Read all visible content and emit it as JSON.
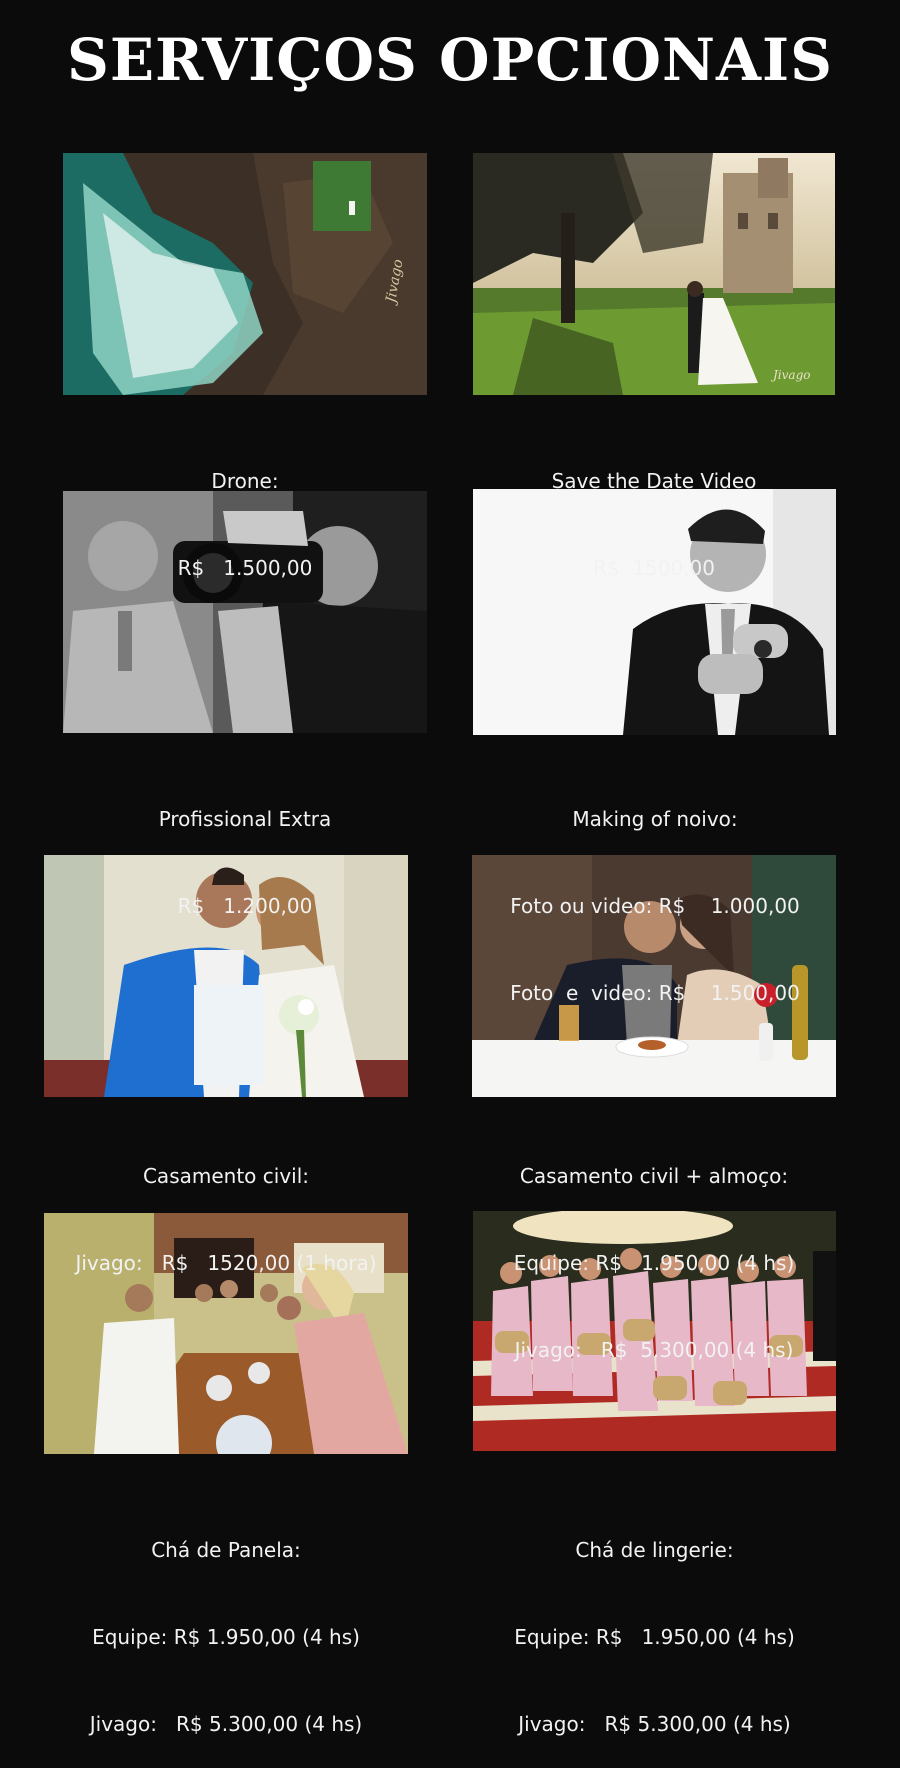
{
  "page": {
    "title": "SERVIÇOS OPCIONAIS"
  },
  "services": [
    {
      "id": "drone",
      "lines": [
        "Drone:",
        "R$   1.500,00"
      ]
    },
    {
      "id": "save-the-date",
      "lines": [
        "Save the Date Video",
        "R$  1500,00"
      ]
    },
    {
      "id": "profissional-extra",
      "lines": [
        "Profissional Extra",
        "R$   1.200,00"
      ]
    },
    {
      "id": "making-of-noivo",
      "lines": [
        "Making of noivo:",
        "Foto ou video: R$    1.000,00",
        "Foto  e  video: R$    1.500,00"
      ]
    },
    {
      "id": "casamento-civil",
      "lines": [
        "Casamento civil:",
        "Jivago:   R$   1520,00 (1 hora)"
      ]
    },
    {
      "id": "casamento-civil-almoco",
      "lines": [
        "Casamento civil + almoço:",
        "Equipe: R$   1.950,00 (4 hs)",
        "Jivago:   R$  5.300,00 (4 hs)"
      ]
    },
    {
      "id": "cha-de-panela",
      "lines": [
        "Chá de Panela:",
        "Equipe: R$ 1.950,00 (4 hs)",
        "Jivago:   R$ 5.300,00 (4 hs)"
      ]
    },
    {
      "id": "cha-de-lingerie",
      "lines": [
        "Chá de lingerie:",
        "Equipe: R$   1.950,00 (4 hs)",
        "Jivago:   R$ 5.300,00 (4 hs)"
      ]
    }
  ],
  "watermarks": {
    "signature": "Jivago"
  }
}
